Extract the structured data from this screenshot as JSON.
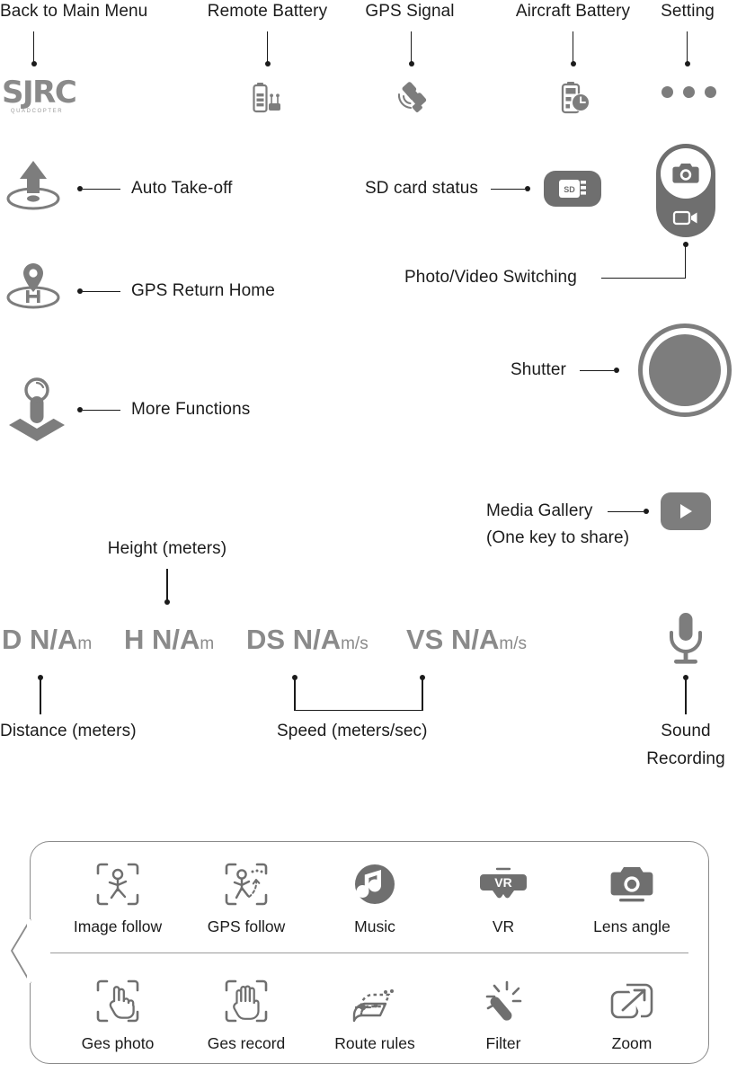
{
  "header": {
    "items": [
      {
        "label": "Back to Main Menu",
        "icon": "sjrc-logo-icon"
      },
      {
        "label": "Remote Battery",
        "icon": "remote-battery-icon"
      },
      {
        "label": "GPS Signal",
        "icon": "gps-satellite-icon"
      },
      {
        "label": "Aircraft Battery",
        "icon": "aircraft-battery-clock-icon"
      },
      {
        "label": "Setting",
        "icon": "more-dots-icon"
      }
    ]
  },
  "brand": {
    "name": "SJRC",
    "tagline": "QUADCOPTER"
  },
  "left_controls": [
    {
      "label": "Auto Take-off",
      "icon": "auto-takeoff-icon"
    },
    {
      "label": "GPS Return Home",
      "icon": "gps-return-home-icon"
    },
    {
      "label": "More Functions",
      "icon": "joystick-more-functions-icon"
    }
  ],
  "right_controls": {
    "sd_card": {
      "label": "SD card status",
      "icon": "sd-card-icon",
      "badge_text": "SD"
    },
    "photo_video": {
      "label": "Photo/Video Switching",
      "icon": "photo-video-toggle-icon"
    },
    "shutter": {
      "label": "Shutter",
      "icon": "shutter-button-icon"
    },
    "media_gallery": {
      "label_line1": "Media Gallery",
      "label_line2": "(One key to share)",
      "icon": "play-media-gallery-icon"
    },
    "sound_recording": {
      "label_line1": "Sound",
      "label_line2": "Recording",
      "icon": "microphone-icon"
    }
  },
  "telemetry": {
    "callouts": {
      "height": "Height (meters)",
      "distance": "Distance (meters)",
      "speed": "Speed (meters/sec)"
    },
    "readouts": [
      {
        "key": "D",
        "value": "N/A",
        "unit": "m"
      },
      {
        "key": "H",
        "value": "N/A",
        "unit": "m"
      },
      {
        "key": "DS",
        "value": "N/A",
        "unit": "m/s"
      },
      {
        "key": "VS",
        "value": "N/A",
        "unit": "m/s"
      }
    ]
  },
  "function_panel": {
    "row1": [
      {
        "label": "Image follow",
        "icon": "image-follow-icon"
      },
      {
        "label": "GPS follow",
        "icon": "gps-follow-icon"
      },
      {
        "label": "Music",
        "icon": "music-note-icon"
      },
      {
        "label": "VR",
        "icon": "vr-goggles-icon",
        "badge_text": "VR"
      },
      {
        "label": "Lens angle",
        "icon": "lens-angle-camera-icon"
      }
    ],
    "row2": [
      {
        "label": "Ges photo",
        "icon": "gesture-photo-icon"
      },
      {
        "label": "Ges record",
        "icon": "gesture-record-icon"
      },
      {
        "label": "Route rules",
        "icon": "route-rules-icon"
      },
      {
        "label": "Filter",
        "icon": "filter-wand-icon"
      },
      {
        "label": "Zoom",
        "icon": "zoom-expand-icon"
      }
    ]
  },
  "colors": {
    "icon_gray": "#7d7d7d",
    "text_black": "#1b1b1b",
    "telemetry_gray": "#8a8a8a",
    "panel_border": "#8b8b8b",
    "control_fill": "#6f6f6f"
  }
}
